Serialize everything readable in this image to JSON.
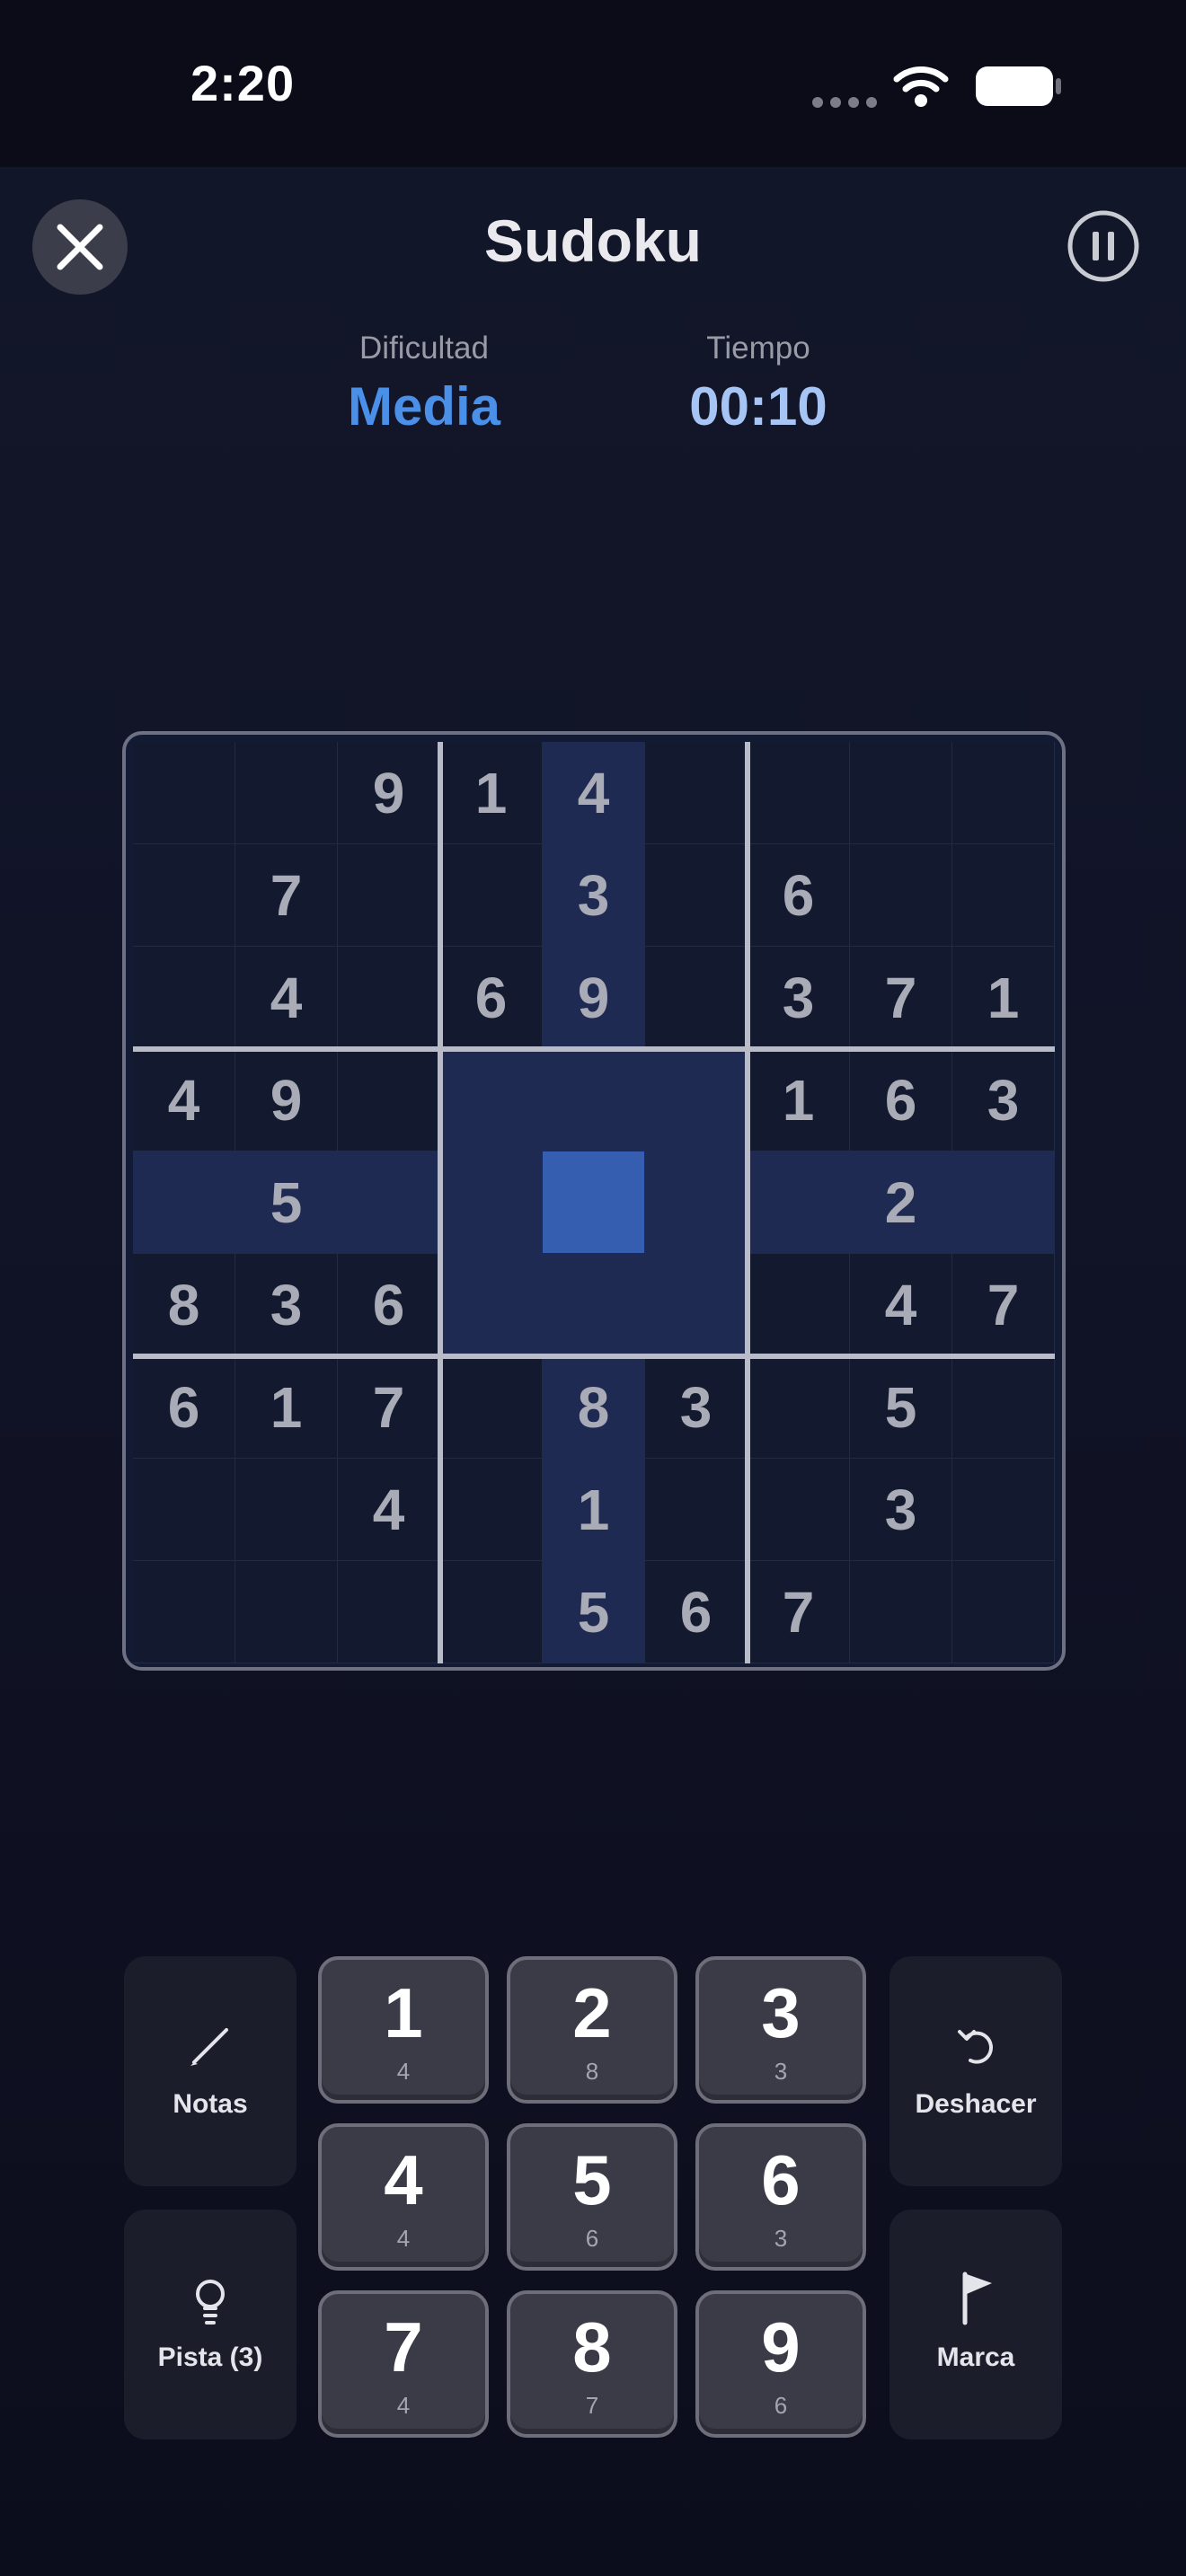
{
  "status_bar": {
    "time": "2:20"
  },
  "header": {
    "title": "Sudoku"
  },
  "info": {
    "difficulty_label": "Dificultad",
    "difficulty_value": "Media",
    "time_label": "Tiempo",
    "time_value": "00:10"
  },
  "colors": {
    "difficulty": "#4a90e8",
    "timer": "#a6c5f5",
    "selected_cell": "#355eb0",
    "highlight": "#1e2a52"
  },
  "board": {
    "rows": [
      [
        "",
        "",
        "9",
        "1",
        "4",
        "",
        "",
        "",
        ""
      ],
      [
        "",
        "7",
        "",
        "",
        "3",
        "",
        "6",
        "",
        ""
      ],
      [
        "",
        "4",
        "",
        "6",
        "9",
        "",
        "3",
        "7",
        "1"
      ],
      [
        "4",
        "9",
        "",
        "",
        "",
        "",
        "1",
        "6",
        "3"
      ],
      [
        "",
        "5",
        "",
        "",
        "",
        "",
        "",
        "2",
        ""
      ],
      [
        "8",
        "3",
        "6",
        "",
        "",
        "",
        "",
        "4",
        "7"
      ],
      [
        "6",
        "1",
        "7",
        "",
        "8",
        "3",
        "",
        "5",
        ""
      ],
      [
        "",
        "",
        "4",
        "",
        "1",
        "",
        "",
        "3",
        ""
      ],
      [
        "",
        "",
        "",
        "",
        "5",
        "6",
        "7",
        "",
        ""
      ]
    ],
    "selected": {
      "row": 5,
      "col": 5
    }
  },
  "tools": {
    "notes": "Notas",
    "hint": "Pista (3)",
    "undo": "Deshacer",
    "mark": "Marca"
  },
  "keypad": [
    {
      "digit": "1",
      "remaining": "4"
    },
    {
      "digit": "2",
      "remaining": "8"
    },
    {
      "digit": "3",
      "remaining": "3"
    },
    {
      "digit": "4",
      "remaining": "4"
    },
    {
      "digit": "5",
      "remaining": "6"
    },
    {
      "digit": "6",
      "remaining": "3"
    },
    {
      "digit": "7",
      "remaining": "4"
    },
    {
      "digit": "8",
      "remaining": "7"
    },
    {
      "digit": "9",
      "remaining": "6"
    }
  ],
  "icons": [
    "close-icon",
    "pause-icon",
    "pencil-icon",
    "lightbulb-icon",
    "undo-icon",
    "flag-icon",
    "wifi-icon",
    "battery-icon"
  ]
}
